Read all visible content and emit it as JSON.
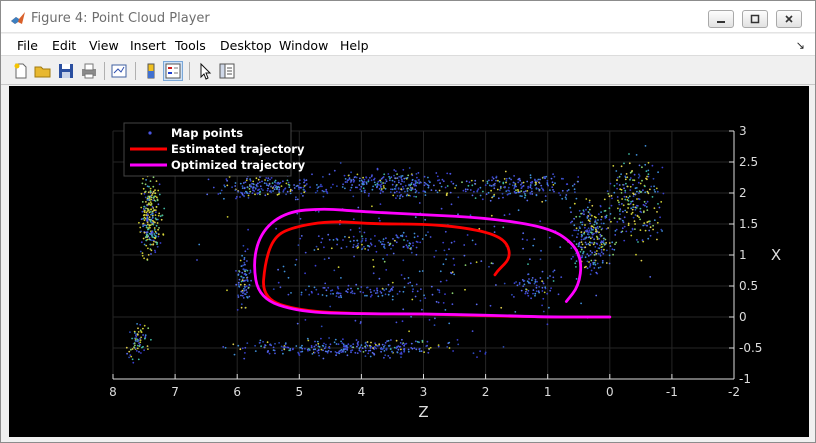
{
  "window": {
    "title": "Figure 4: Point Cloud Player",
    "minimize_label": "minimize",
    "maximize_label": "maximize",
    "close_label": "close"
  },
  "menu": {
    "items": [
      "File",
      "Edit",
      "View",
      "Insert",
      "Tools",
      "Desktop",
      "Window",
      "Help"
    ]
  },
  "toolbar": {
    "buttons": [
      "new-figure-icon",
      "open-file-icon",
      "save-icon",
      "print-icon",
      "link-plot-icon",
      "colorbar-icon",
      "legend-icon",
      "pointer-icon",
      "property-inspector-icon"
    ]
  },
  "plot": {
    "xlabel": "Z",
    "ylabel": "X",
    "xticks": [
      "8",
      "7",
      "6",
      "5",
      "4",
      "3",
      "2",
      "1",
      "0",
      "-1",
      "-2"
    ],
    "yticks": [
      "3",
      "2.5",
      "2",
      "1.5",
      "1",
      "0.5",
      "0",
      "-0.5",
      "-1"
    ],
    "legend": {
      "map_points": "Map points",
      "estimated": "Estimated trajectory",
      "optimized": "Optimized trajectory"
    },
    "colors": {
      "estimated": "#ff0000",
      "optimized": "#ff00ff",
      "background": "#000000",
      "points_low": "#3b3fd0",
      "points_high": "#d8d83a"
    }
  },
  "chart_data": {
    "type": "scatter",
    "title": "",
    "xlabel": "Z",
    "ylabel": "X",
    "xlim": [
      8,
      -2
    ],
    "ylim": [
      -1,
      3
    ],
    "grid": true,
    "legend_position": "top-left",
    "series": [
      {
        "name": "Estimated trajectory",
        "color": "#ff0000",
        "x": [
          0.0,
          0.5,
          1.0,
          2.0,
          3.0,
          4.0,
          5.0,
          5.6,
          5.55,
          5.4,
          5.1,
          4.5,
          3.8,
          3.0,
          2.4,
          1.9,
          1.65,
          1.6,
          1.8,
          1.85
        ],
        "y": [
          0.0,
          0.0,
          0.0,
          0.02,
          0.05,
          0.05,
          0.1,
          0.3,
          0.9,
          1.3,
          1.45,
          1.55,
          1.5,
          1.5,
          1.45,
          1.35,
          1.2,
          0.95,
          0.75,
          0.68
        ]
      },
      {
        "name": "Optimized trajectory",
        "color": "#ff00ff",
        "x": [
          0.0,
          0.5,
          1.0,
          2.0,
          3.0,
          4.0,
          5.0,
          5.65,
          5.75,
          5.6,
          5.2,
          4.6,
          4.0,
          3.0,
          2.0,
          1.0,
          0.6,
          0.45,
          0.5,
          0.7
        ],
        "y": [
          0.0,
          0.0,
          0.0,
          0.03,
          0.05,
          0.05,
          0.08,
          0.3,
          0.9,
          1.4,
          1.7,
          1.75,
          1.7,
          1.65,
          1.6,
          1.45,
          1.2,
          0.9,
          0.5,
          0.25
        ]
      }
    ]
  }
}
